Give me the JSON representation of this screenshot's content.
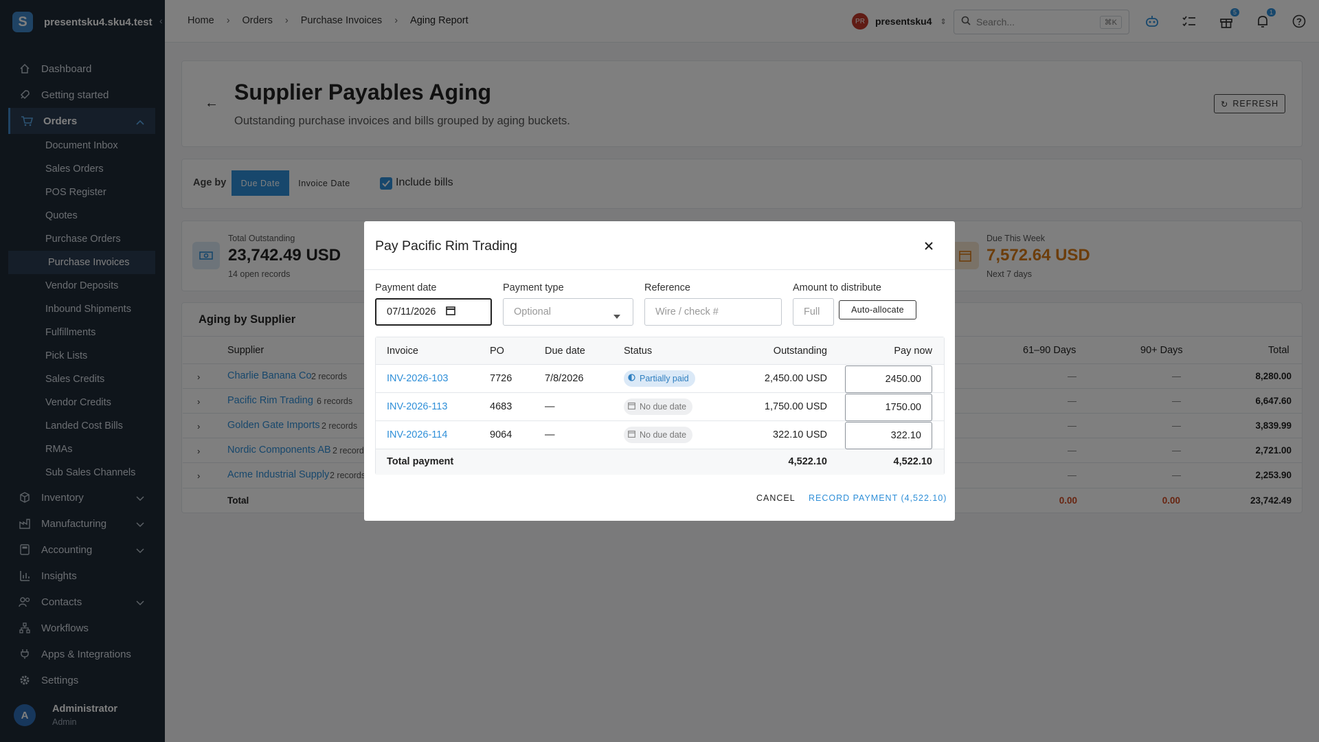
{
  "app": {
    "name": "presentsku4.sku4.test",
    "logo_letter": "S"
  },
  "sidebar": {
    "items": [
      {
        "label": "Dashboard"
      },
      {
        "label": "Getting started"
      },
      {
        "label": "Orders"
      },
      {
        "label": "Inventory"
      },
      {
        "label": "Manufacturing"
      },
      {
        "label": "Accounting"
      },
      {
        "label": "Insights"
      },
      {
        "label": "Contacts"
      },
      {
        "label": "Workflows"
      },
      {
        "label": "Apps & Integrations"
      },
      {
        "label": "Settings"
      }
    ],
    "orders_sub": [
      "Document Inbox",
      "Sales Orders",
      "POS Register",
      "Quotes",
      "Purchase Orders",
      "Purchase Invoices",
      "Vendor Deposits",
      "Inbound Shipments",
      "Fulfillments",
      "Pick Lists",
      "Sales Credits",
      "Vendor Credits",
      "Landed Cost Bills",
      "RMAs",
      "Sub Sales Channels"
    ],
    "user": {
      "initial": "A",
      "name": "Administrator",
      "role": "Admin"
    }
  },
  "topbar": {
    "breadcrumbs": [
      "Home",
      "Orders",
      "Purchase Invoices",
      "Aging Report"
    ],
    "org": {
      "initials": "PR",
      "name": "presentsku4"
    },
    "search": {
      "placeholder": "Search...",
      "shortcut": "⌘K"
    },
    "badges": {
      "gifts": "5",
      "notifications": "1"
    }
  },
  "page": {
    "title": "Supplier Payables Aging",
    "subtitle": "Outstanding purchase invoices and bills grouped by aging buckets.",
    "refresh": "REFRESH",
    "age_by_label": "Age by",
    "age_by_options": [
      "Due Date",
      "Invoice Date"
    ],
    "include_bills": "Include bills",
    "stats": {
      "total": {
        "label": "Total Outstanding",
        "value": "23,742.49 USD",
        "sub": "14 open records"
      },
      "week": {
        "label": "Due This Week",
        "value": "7,572.64 USD",
        "sub": "Next 7 days"
      }
    },
    "aging": {
      "title": "Aging by Supplier",
      "headers": {
        "supplier": "Supplier",
        "d61_90": "61–90 Days",
        "d90": "90+ Days",
        "total": "Total"
      },
      "rows": [
        {
          "supplier": "Charlie Banana Co",
          "records": "2 records",
          "d61_90": "—",
          "d90": "—",
          "total": "8,280.00"
        },
        {
          "supplier": "Pacific Rim Trading",
          "records": "6 records",
          "d61_90": "—",
          "d90": "—",
          "total": "6,647.60"
        },
        {
          "supplier": "Golden Gate Imports",
          "records": "2 records",
          "d61_90": "—",
          "d90": "—",
          "total": "3,839.99"
        },
        {
          "supplier": "Nordic Components AB",
          "records": "2 records",
          "d61_90": "—",
          "d90": "—",
          "total": "2,721.00"
        },
        {
          "supplier": "Acme Industrial Supply",
          "records": "2 records",
          "d61_90": "—",
          "d90": "—",
          "total": "2,253.90"
        }
      ],
      "total_row": {
        "label": "Total",
        "d61_90": "0.00",
        "d90": "0.00",
        "total": "23,742.49"
      }
    }
  },
  "modal": {
    "title": "Pay Pacific Rim Trading",
    "fields": {
      "payment_date": {
        "label": "Payment date",
        "value": "07/11/2026"
      },
      "payment_type": {
        "label": "Payment type",
        "placeholder": "Optional"
      },
      "reference": {
        "label": "Reference",
        "placeholder": "Wire / check #"
      },
      "amount": {
        "label": "Amount to distribute",
        "placeholder": "Full"
      }
    },
    "auto_allocate": "Auto-allocate",
    "table": {
      "headers": {
        "invoice": "Invoice",
        "po": "PO",
        "due": "Due date",
        "status": "Status",
        "outstanding": "Outstanding",
        "pay": "Pay now"
      },
      "rows": [
        {
          "invoice": "INV-2026-103",
          "po": "7726",
          "due": "7/8/2026",
          "status": "Partially paid",
          "outstanding": "2,450.00 USD",
          "pay": "2450.00"
        },
        {
          "invoice": "INV-2026-113",
          "po": "4683",
          "due": "—",
          "status": "No due date",
          "outstanding": "1,750.00 USD",
          "pay": "1750.00"
        },
        {
          "invoice": "INV-2026-114",
          "po": "9064",
          "due": "—",
          "status": "No due date",
          "outstanding": "322.10 USD",
          "pay": "322.10"
        }
      ],
      "total": {
        "label": "Total payment",
        "outstanding": "4,522.10",
        "pay": "4,522.10"
      }
    },
    "cancel": "CANCEL",
    "record": "RECORD PAYMENT (4,522.10)"
  },
  "colors": {
    "accent": "#2f8fd8",
    "sidebar": "#1f2a37",
    "warning": "#d97a16",
    "danger": "#d04a22"
  }
}
